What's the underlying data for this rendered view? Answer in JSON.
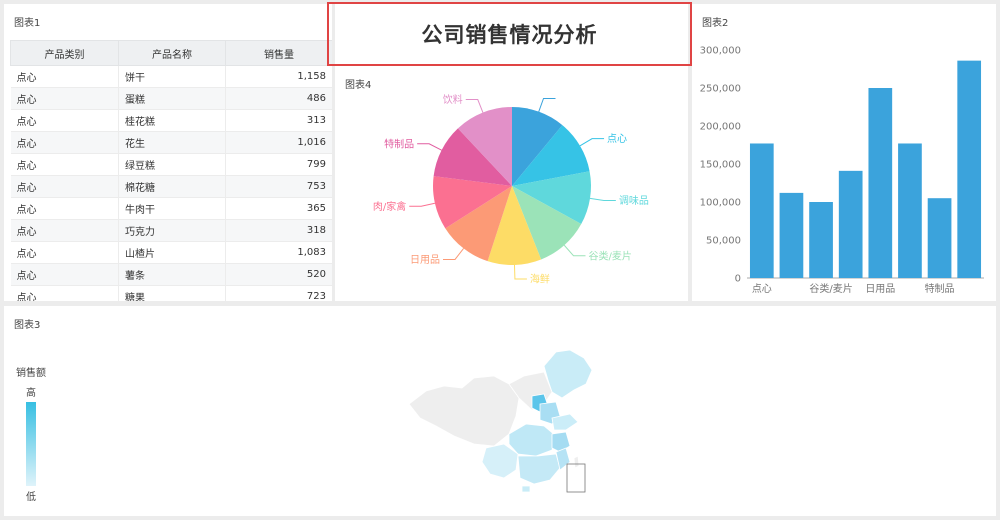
{
  "header": {
    "title": "公司销售情况分析"
  },
  "table_panel": {
    "title": "图表1",
    "columns": [
      "产品类别",
      "产品名称",
      "销售量"
    ],
    "rows": [
      [
        "点心",
        "饼干",
        "1,158"
      ],
      [
        "点心",
        "蛋糕",
        "486"
      ],
      [
        "点心",
        "桂花糕",
        "313"
      ],
      [
        "点心",
        "花生",
        "1,016"
      ],
      [
        "点心",
        "绿豆糕",
        "799"
      ],
      [
        "点心",
        "棉花糖",
        "753"
      ],
      [
        "点心",
        "牛肉干",
        "365"
      ],
      [
        "点心",
        "巧克力",
        "318"
      ],
      [
        "点心",
        "山楂片",
        "1,083"
      ],
      [
        "点心",
        "薯条",
        "520"
      ],
      [
        "点心",
        "糖果",
        "723"
      ]
    ]
  },
  "pie_panel": {
    "title": "图表4"
  },
  "bar_panel": {
    "title": "图表2"
  },
  "map_panel": {
    "title": "图表3",
    "legend_title": "销售额",
    "legend_high": "高",
    "legend_low": "低"
  },
  "colors": {
    "accent": "#3ba3dc",
    "title_border": "#e04444"
  },
  "chart_data": [
    {
      "type": "pie",
      "categories": [
        "",
        "点心",
        "调味品",
        "谷类/麦片",
        "海鲜",
        "日用品",
        "肉/家禽",
        "特制品",
        "饮料"
      ],
      "values": [
        11,
        11,
        11,
        11,
        11,
        11,
        11,
        11,
        12
      ],
      "colors": [
        "#3ba3dc",
        "#36c3e6",
        "#5fd8dc",
        "#9be3b8",
        "#fddc66",
        "#fc9a76",
        "#fb7091",
        "#e15da0",
        "#e290c8"
      ]
    },
    {
      "type": "bar",
      "categories": [
        "点心",
        "",
        "谷类/麦片",
        "",
        "日用品",
        "",
        "特制品",
        ""
      ],
      "values": [
        177000,
        112000,
        100000,
        141000,
        250000,
        177000,
        105000,
        286000
      ],
      "ylim": [
        0,
        300000
      ],
      "yticks": [
        "0",
        "50,000",
        "100,000",
        "150,000",
        "200,000",
        "250,000",
        "300,000"
      ],
      "color": "#3ba3dc"
    }
  ]
}
